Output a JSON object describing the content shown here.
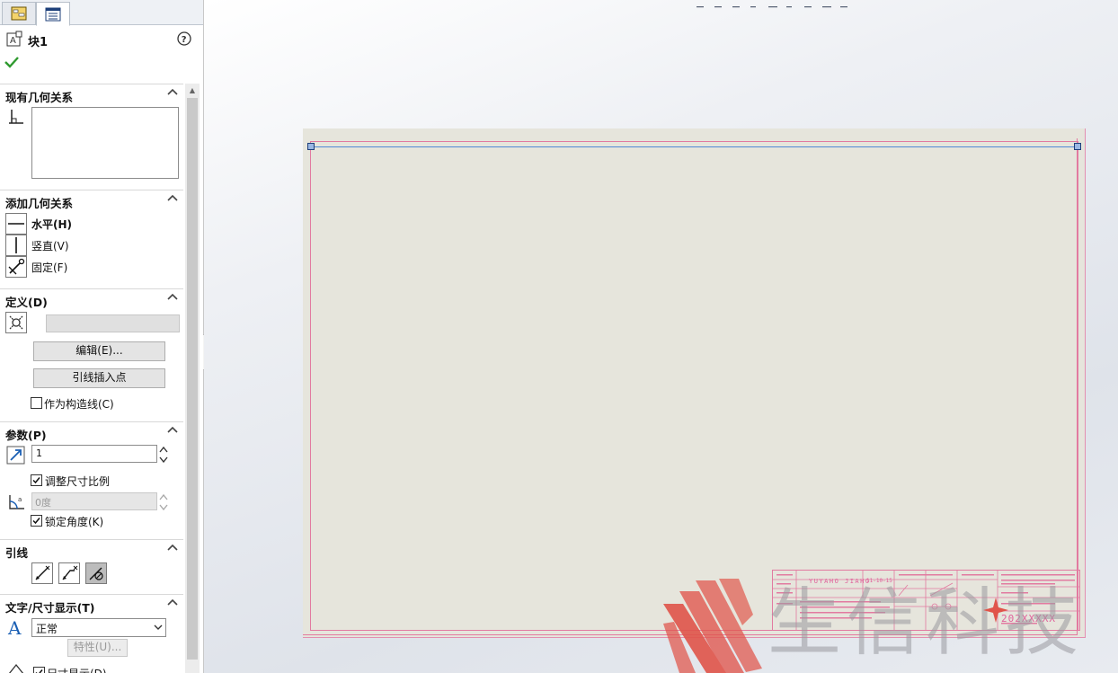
{
  "panel": {
    "title": "块1",
    "sections": {
      "existing_relations": "现有几何关系",
      "add_relations": "添加几何关系",
      "define": "定义(D)",
      "params": "参数(P)",
      "leader": "引线",
      "text_dim": "文字/尺寸显示(T)"
    },
    "relations": [
      {
        "label": "水平(H)",
        "bold": true
      },
      {
        "label": "竖直(V)",
        "bold": false
      },
      {
        "label": "固定(F)",
        "bold": false
      }
    ],
    "define": {
      "edit_button": "编辑(E)...",
      "leader_insert_button": "引线插入点",
      "construction_checkbox": "作为构造线(C)",
      "construction_checked": false
    },
    "params": {
      "scale_value": "1",
      "scale_checkbox": "调整尺寸比例",
      "scale_checked": true,
      "angle_value": "0度",
      "lock_angle_checkbox": "锁定角度(K)",
      "lock_angle_checked": true
    },
    "text_dim": {
      "style_value": "正常",
      "properties_button": "特性(U)...",
      "cut_text": "尺寸显示(D)"
    }
  },
  "titleblock": {
    "designer": "YUYAHO JIAHO",
    "date": "11-10-15",
    "part_no": "202XXXXX"
  },
  "watermark": {
    "text": "生信科技",
    "colors": {
      "stripes": "#e0544a",
      "text": "#9a9aa0"
    }
  },
  "colors": {
    "accent_pink": "#e27aa0",
    "sheet": "#e6e5dc",
    "check_green": "#2f9a2f"
  }
}
